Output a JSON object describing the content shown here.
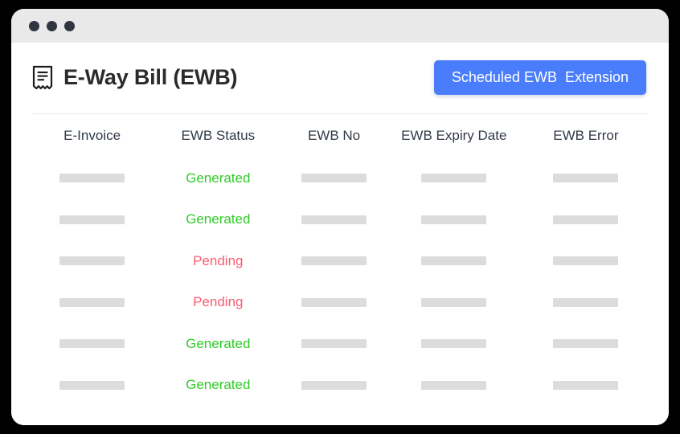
{
  "window": {
    "traffic_lights": [
      "close",
      "minimize",
      "maximize"
    ]
  },
  "header": {
    "icon": "receipt-icon",
    "title": "E-Way Bill (EWB)",
    "action_button": {
      "label": "Scheduled EWB  Extension",
      "color": "#4a7dfb",
      "text_color": "#ffffff"
    }
  },
  "table": {
    "columns": [
      "E-Invoice",
      "EWB Status",
      "EWB No",
      "EWB Expiry Date",
      "EWB Error"
    ],
    "rows": [
      {
        "e_invoice": "",
        "ewb_status": "Generated",
        "ewb_no": "",
        "ewb_expiry_date": "",
        "ewb_error": ""
      },
      {
        "e_invoice": "",
        "ewb_status": "Generated",
        "ewb_no": "",
        "ewb_expiry_date": "",
        "ewb_error": ""
      },
      {
        "e_invoice": "",
        "ewb_status": "Pending",
        "ewb_no": "",
        "ewb_expiry_date": "",
        "ewb_error": ""
      },
      {
        "e_invoice": "",
        "ewb_status": "Pending",
        "ewb_no": "",
        "ewb_expiry_date": "",
        "ewb_error": ""
      },
      {
        "e_invoice": "",
        "ewb_status": "Generated",
        "ewb_no": "",
        "ewb_expiry_date": "",
        "ewb_error": ""
      },
      {
        "e_invoice": "",
        "ewb_status": "Generated",
        "ewb_no": "",
        "ewb_expiry_date": "",
        "ewb_error": ""
      }
    ]
  },
  "status_colors": {
    "Generated": "#2ecc26",
    "Pending": "#fb5d72"
  },
  "placeholder": {
    "style": "skeleton-bar",
    "color": "#dcdcdc"
  }
}
